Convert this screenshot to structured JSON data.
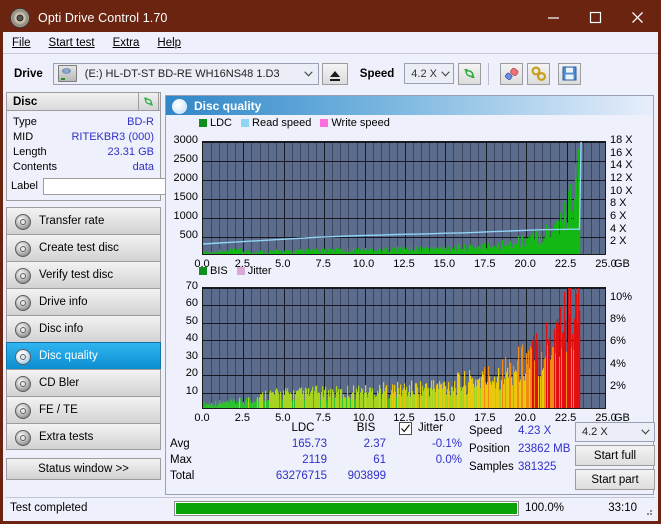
{
  "window": {
    "title": "Opti Drive Control 1.70",
    "icon": "disc-icon",
    "minimize": "–",
    "maximize": "□",
    "close": "✕"
  },
  "menubar": {
    "items": [
      {
        "label": "File"
      },
      {
        "label": "Start test"
      },
      {
        "label": "Extra"
      },
      {
        "label": "Help"
      }
    ]
  },
  "toolbar": {
    "drive_label": "Drive",
    "drive_value": "(E:)  HL-DT-ST BD-RE  WH16NS48 1.D3",
    "eject_icon": "eject-icon",
    "speed_label": "Speed",
    "speed_value": "4.2 X",
    "refresh_icon": "refresh-icon",
    "erase_icon": "eraser-icon",
    "tools_icon": "tools-icon",
    "save_icon": "save-icon"
  },
  "disc_panel": {
    "title": "Disc",
    "refresh_icon": "refresh-icon",
    "rows": [
      {
        "key": "Type",
        "value": "BD-R"
      },
      {
        "key": "MID",
        "value": "RITEKBR3 (000)"
      },
      {
        "key": "Length",
        "value": "23.31 GB"
      },
      {
        "key": "Contents",
        "value": "data"
      }
    ],
    "label_key": "Label",
    "label_value": "",
    "label_placeholder": "",
    "disc_icon": "disc-icon"
  },
  "nav": {
    "items": [
      {
        "label": "Transfer rate",
        "icon": "disc-icon",
        "active": false
      },
      {
        "label": "Create test disc",
        "icon": "disc-icon",
        "active": false
      },
      {
        "label": "Verify test disc",
        "icon": "disc-icon",
        "active": false
      },
      {
        "label": "Drive info",
        "icon": "disc-icon",
        "active": false
      },
      {
        "label": "Disc info",
        "icon": "disc-icon",
        "active": false
      },
      {
        "label": "Disc quality",
        "icon": "disc-icon",
        "active": true
      },
      {
        "label": "CD Bler",
        "icon": "disc-icon",
        "active": false
      },
      {
        "label": "FE / TE",
        "icon": "disc-icon",
        "active": false
      },
      {
        "label": "Extra tests",
        "icon": "disc-icon",
        "active": false
      }
    ],
    "status_window": "Status window >>"
  },
  "main": {
    "header": "Disc quality",
    "header_icon": "disc-icon"
  },
  "stats": {
    "col_ldc": "LDC",
    "col_bis": "BIS",
    "rows": [
      {
        "label": "Avg",
        "ldc": "165.73",
        "bis": "2.37",
        "jitter": "-0.1%"
      },
      {
        "label": "Max",
        "ldc": "2119",
        "bis": "61",
        "jitter": "0.0%"
      },
      {
        "label": "Total",
        "ldc": "63276715",
        "bis": "903899",
        "jitter": ""
      }
    ],
    "jitter_label": "Jitter",
    "jitter_checked": true,
    "speed_label": "Speed",
    "speed_value": "4.23 X",
    "position_label": "Position",
    "position_value": "23862 MB",
    "samples_label": "Samples",
    "samples_value": "381325",
    "speed_select": "4.2 X",
    "start_full": "Start full",
    "start_part": "Start part"
  },
  "statusbar": {
    "message": "Test completed",
    "progress_percent": "100.0%",
    "progress_value": 100,
    "elapsed": "33:10"
  },
  "colors": {
    "title_bar": "#6b2410",
    "accent": "#3030cc",
    "plot_bg": "#5c6c8c",
    "ldc_green": "#14b814",
    "read_speed": "#8fd4f5",
    "write_speed": "#ff6ee0",
    "bis_green": "#14b814",
    "jitter_pink": "#d8a8d8",
    "progress_green": "#09a209",
    "active_nav": "#0c8ed0"
  },
  "chart_data": [
    {
      "type": "area",
      "name": "disc-quality-ldc-chart",
      "title": "",
      "xlabel": "GB",
      "ylabel": "LDC",
      "xlim": [
        0,
        25
      ],
      "ylim": [
        0,
        3000
      ],
      "y2lim": [
        0,
        18
      ],
      "y2label": "X",
      "grid": true,
      "legend_position": "top-left",
      "xticks": [
        "0.0",
        "2.5",
        "5.0",
        "7.5",
        "10.0",
        "12.5",
        "15.0",
        "17.5",
        "20.0",
        "22.5",
        "25.0"
      ],
      "yticks": [
        "500",
        "1000",
        "1500",
        "2000",
        "2500",
        "3000"
      ],
      "y2ticks": [
        "2 X",
        "4 X",
        "6 X",
        "8 X",
        "10 X",
        "12 X",
        "14 X",
        "16 X",
        "18 X"
      ],
      "legend": [
        {
          "label": "LDC",
          "color": "#0e8f1e"
        },
        {
          "label": "Read speed",
          "color": "#8fd4f5"
        },
        {
          "label": "Write speed",
          "color": "#ff6ee0"
        }
      ],
      "series": [
        {
          "name": "LDC",
          "color": "#14b814",
          "kind": "area",
          "x": [
            0.0,
            0.5,
            1.0,
            1.5,
            2.0,
            2.5,
            3.0,
            3.5,
            4.0,
            4.5,
            5.0,
            5.5,
            6.0,
            6.5,
            7.0,
            7.5,
            8.0,
            8.5,
            9.0,
            9.5,
            10.0,
            10.5,
            11.0,
            11.5,
            12.0,
            12.5,
            13.0,
            13.5,
            14.0,
            14.5,
            15.0,
            15.5,
            16.0,
            16.5,
            17.0,
            17.5,
            18.0,
            18.5,
            19.0,
            19.5,
            20.0,
            20.5,
            21.0,
            21.5,
            22.0,
            22.5,
            23.0,
            23.3,
            23.5
          ],
          "values": [
            90,
            95,
            130,
            100,
            180,
            115,
            105,
            110,
            115,
            120,
            125,
            120,
            130,
            135,
            130,
            140,
            145,
            140,
            150,
            155,
            150,
            160,
            165,
            160,
            170,
            180,
            175,
            185,
            195,
            190,
            205,
            215,
            210,
            230,
            250,
            245,
            270,
            300,
            330,
            360,
            400,
            470,
            560,
            680,
            860,
            1150,
            1700,
            2119,
            0
          ]
        },
        {
          "name": "Read speed",
          "color": "#8fd4f5",
          "kind": "line",
          "axis": "y2",
          "x": [
            0.0,
            1.0,
            2.0,
            3.0,
            4.0,
            5.0,
            6.0,
            7.0,
            8.0,
            9.0,
            10.0,
            11.0,
            12.0,
            13.0,
            14.0,
            15.0,
            16.0,
            17.0,
            18.0,
            19.0,
            20.0,
            21.0,
            22.0,
            23.0,
            23.3,
            23.4
          ],
          "values": [
            1.9,
            2.05,
            2.2,
            2.35,
            2.5,
            2.65,
            2.8,
            2.95,
            3.05,
            3.15,
            3.25,
            3.3,
            3.4,
            3.45,
            3.5,
            3.6,
            3.65,
            3.75,
            3.85,
            3.95,
            4.05,
            4.15,
            4.2,
            4.23,
            4.23,
            18.0
          ]
        },
        {
          "name": "Write speed",
          "color": "#ff6ee0",
          "kind": "line",
          "axis": "y2",
          "x": [],
          "values": []
        }
      ]
    },
    {
      "type": "area",
      "name": "disc-quality-bis-chart",
      "title": "",
      "xlabel": "GB",
      "ylabel": "BIS",
      "xlim": [
        0,
        25
      ],
      "ylim": [
        0,
        70
      ],
      "y2lim": [
        0,
        11
      ],
      "y2label": "%",
      "grid": true,
      "legend_position": "top-left",
      "xticks": [
        "0.0",
        "2.5",
        "5.0",
        "7.5",
        "10.0",
        "12.5",
        "15.0",
        "17.5",
        "20.0",
        "22.5",
        "25.0"
      ],
      "yticks": [
        "10",
        "20",
        "30",
        "40",
        "50",
        "60",
        "70"
      ],
      "y2ticks": [
        "2%",
        "4%",
        "6%",
        "8%",
        "10%"
      ],
      "legend": [
        {
          "label": "BIS",
          "color": "#0e8f1e"
        },
        {
          "label": "Jitter",
          "color": "#d8a8d8"
        }
      ],
      "series": [
        {
          "name": "BIS",
          "color": "#14b814",
          "kind": "area",
          "x": [
            0.0,
            0.5,
            1.0,
            1.5,
            2.0,
            2.5,
            3.0,
            3.5,
            4.0,
            4.5,
            5.0,
            5.5,
            6.0,
            6.5,
            7.0,
            7.5,
            8.0,
            8.5,
            9.0,
            9.5,
            10.0,
            10.5,
            11.0,
            11.5,
            12.0,
            12.5,
            13.0,
            13.5,
            14.0,
            14.5,
            15.0,
            15.5,
            16.0,
            16.5,
            17.0,
            17.5,
            18.0,
            18.5,
            19.0,
            19.5,
            20.0,
            20.5,
            21.0,
            21.5,
            22.0,
            22.5,
            23.0,
            23.3,
            23.5
          ],
          "values": [
            3,
            3.5,
            4,
            4,
            4.5,
            5,
            6,
            7,
            9,
            8.5,
            9,
            8.5,
            9,
            9,
            9.5,
            9,
            9.5,
            9,
            10,
            10,
            10,
            10.5,
            11,
            10.5,
            11,
            11.5,
            11.5,
            12,
            12.5,
            13,
            13.5,
            14,
            15,
            15.5,
            17,
            18,
            19,
            21,
            23,
            25,
            28,
            31,
            35,
            40,
            46,
            52,
            58,
            61,
            0
          ]
        },
        {
          "name": "Jitter",
          "color": "#d8a8d8",
          "kind": "line",
          "axis": "y2",
          "x": [],
          "values": []
        }
      ]
    }
  ]
}
